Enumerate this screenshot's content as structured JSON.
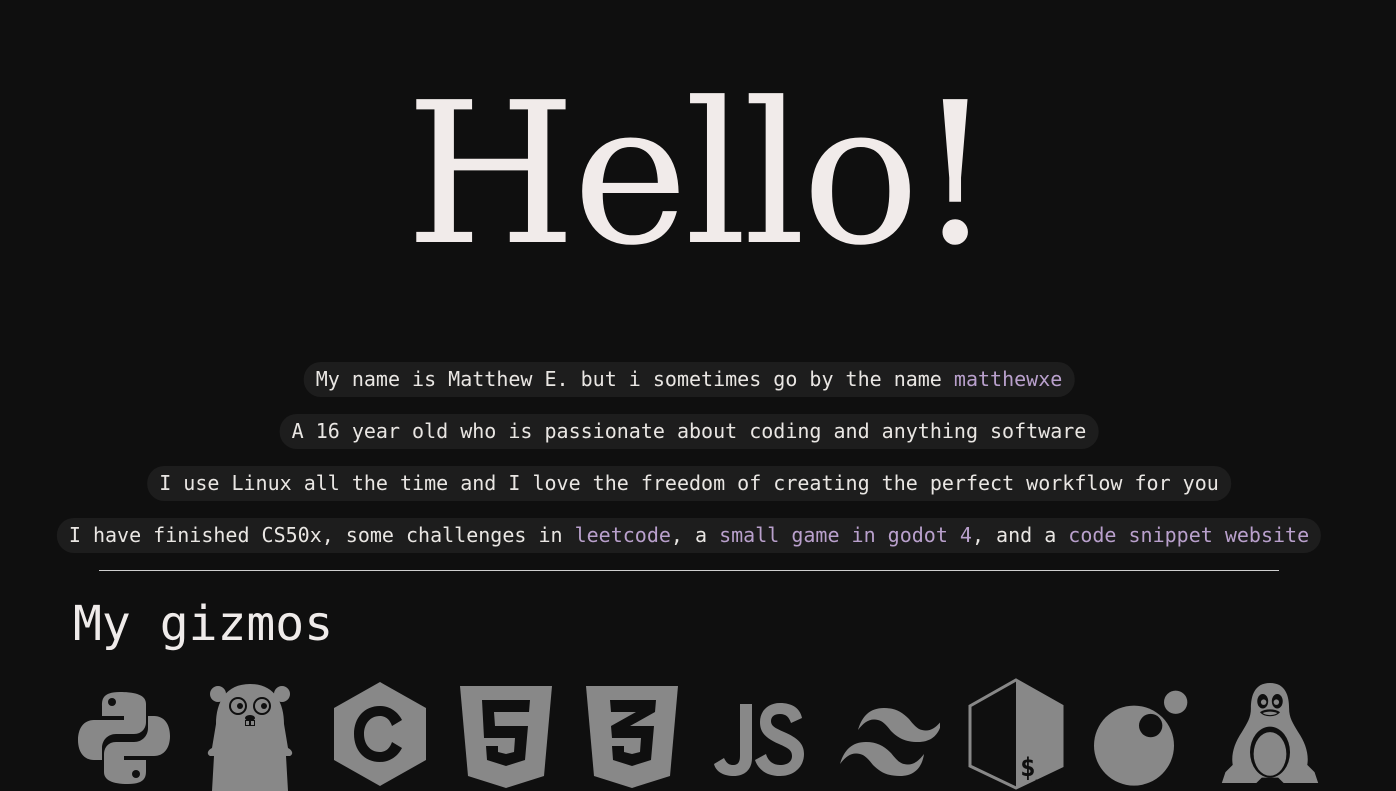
{
  "hero": {
    "title": "Hello!"
  },
  "intro": {
    "line1": {
      "text": "My name is Matthew E. but i sometimes go by the name ",
      "link": "matthewxe"
    },
    "line2": {
      "text": "A 16 year old who is passionate about coding and anything software"
    },
    "line3": {
      "text": "I use Linux all the time and I love the freedom of creating the perfect workflow for you"
    },
    "line4": {
      "part1": "I have finished CS50x, some challenges in ",
      "link1": "leetcode",
      "part2": ", a ",
      "link2": "small game in godot 4",
      "part3": ", and a ",
      "link3": "code snippet website"
    }
  },
  "gizmos": {
    "title": "My gizmos",
    "icons": [
      "python-icon",
      "gopher-icon",
      "c-language-icon",
      "html5-icon",
      "css3-icon",
      "javascript-icon",
      "tailwind-icon",
      "bash-icon",
      "godot-orb-icon",
      "linux-tux-icon"
    ]
  },
  "colors": {
    "background": "#0f0f0f",
    "text": "#efebea",
    "pill": "#1d1d1d",
    "link": "#b9a0cc",
    "icon": "#888888"
  }
}
